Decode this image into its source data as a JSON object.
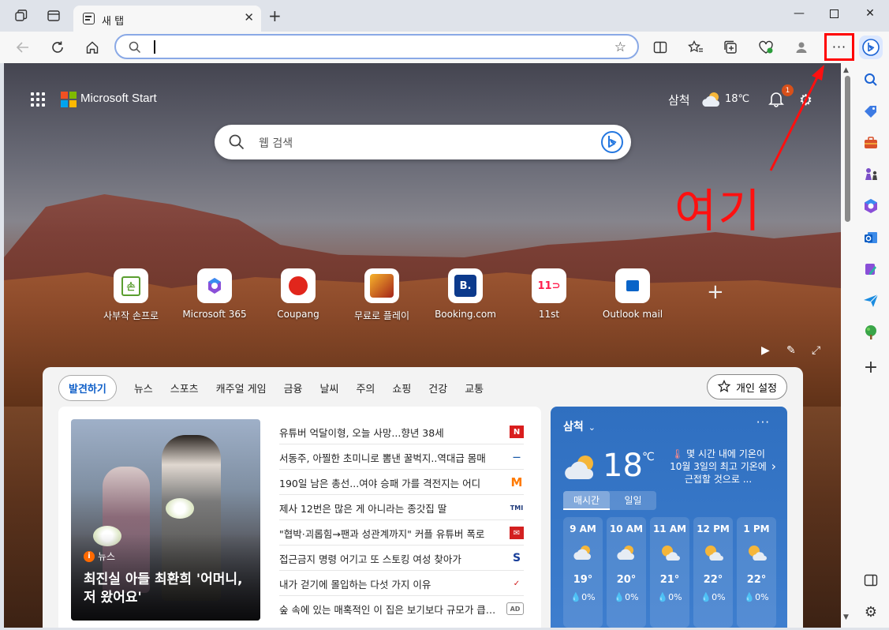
{
  "tab": {
    "title": "새 탭"
  },
  "address": {
    "value": ""
  },
  "start": {
    "brand": "Microsoft Start",
    "location": "삼척",
    "temp": "18℃",
    "notifications": "1",
    "search_placeholder": "웹 검색"
  },
  "annotation": {
    "text": "여기",
    "color": "#ff0000"
  },
  "quick_links": [
    {
      "label": "사부작 손프로",
      "icon": "son-pro-icon"
    },
    {
      "label": "Microsoft 365",
      "icon": "m365-icon"
    },
    {
      "label": "Coupang",
      "icon": "coupang-icon"
    },
    {
      "label": "무료로 플레이",
      "icon": "game-icon"
    },
    {
      "label": "Booking.com",
      "icon": "booking-icon"
    },
    {
      "label": "11st",
      "icon": "11st-icon"
    },
    {
      "label": "Outlook mail",
      "icon": "outlook-icon"
    }
  ],
  "feed": {
    "nav": [
      "발견하기",
      "뉴스",
      "스포츠",
      "캐주얼 게임",
      "금융",
      "날씨",
      "주의",
      "쇼핑",
      "건강",
      "교통"
    ],
    "personalize": "개인 설정",
    "hero": {
      "source": "뉴스",
      "title": "최진실 아들 최환희 '어머니, 저 왔어요'"
    },
    "headlines": [
      {
        "text": "유튜버 억달이형, 오늘 사망...향년 38세",
        "logo": "N",
        "color": "#d91d1d"
      },
      {
        "text": "서동주, 아찔한 초미니로 뽐낸 꿀벅지..역대급 몸매",
        "logo": "—",
        "color": "#1a5aa8"
      },
      {
        "text": "190일 남은 총선...여야 승패 가를 격전지는 어디",
        "logo": "M",
        "color": "#ff7a00"
      },
      {
        "text": "제사 12번은 많은 게 아니라는 종갓집 딸",
        "logo": "TMI",
        "color": "#1f3a7a"
      },
      {
        "text": "\"협박·괴롭힘→팬과 성관계까지\" 커플 유튜버 폭로",
        "logo": "✉",
        "color": "#d32020"
      },
      {
        "text": "접근금지 명령 어기고 또 스토킹 여성 찾아가",
        "logo": "S",
        "color": "#1a3f9a"
      },
      {
        "text": "내가 걷기에 몰입하는 다섯 가지 이유",
        "logo": "✓",
        "color": "#d01a1a"
      },
      {
        "text": "숲 속에 있는 매혹적인 이 집은 보기보다 규모가 큽니다",
        "logo": "AD",
        "color": "#666666"
      }
    ]
  },
  "weather": {
    "location": "삼척",
    "temp": "18",
    "unit": "℃",
    "alert": "몇 시간 내에 기온이 10월 3일의 최고 기온에 근접할 것으로 ...",
    "tabs": [
      "매시간",
      "일일"
    ],
    "hours": [
      {
        "time": "9 AM",
        "temp": "19°",
        "rain": "0%"
      },
      {
        "time": "10 AM",
        "temp": "20°",
        "rain": "0%"
      },
      {
        "time": "11 AM",
        "temp": "21°",
        "rain": "0%"
      },
      {
        "time": "12 PM",
        "temp": "22°",
        "rain": "0%"
      },
      {
        "time": "1 PM",
        "temp": "22°",
        "rain": "0%"
      }
    ]
  }
}
